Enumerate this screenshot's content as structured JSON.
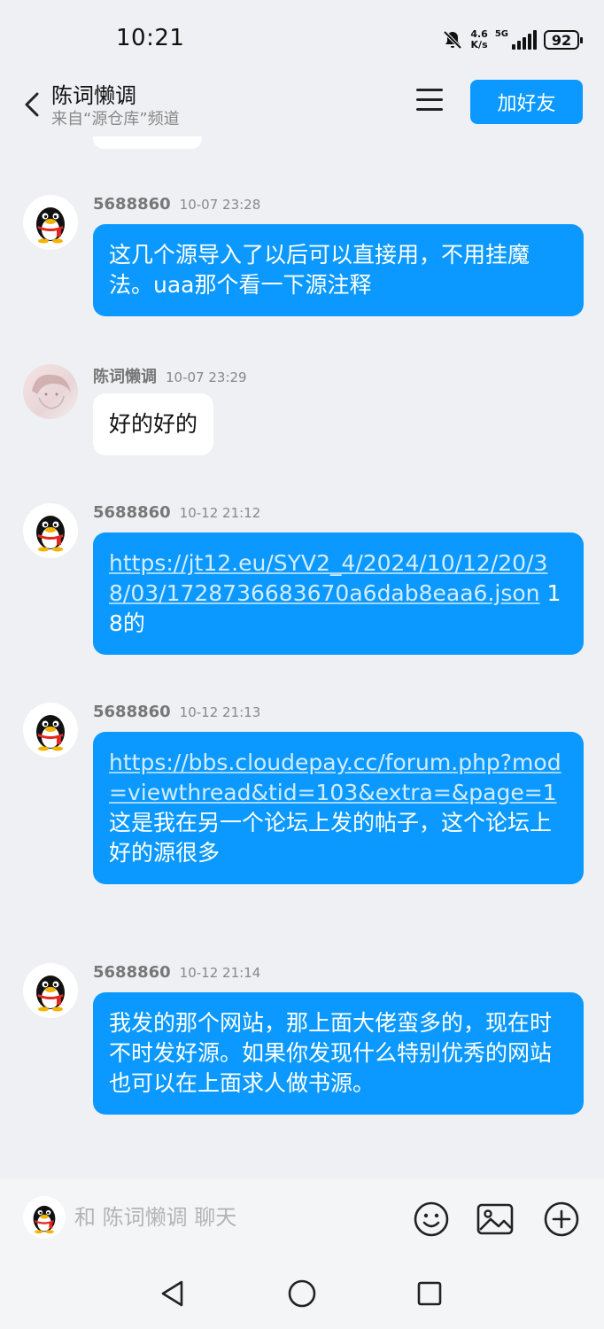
{
  "status_bar": {
    "time": "10:21",
    "net_speed_value": "4.6",
    "net_speed_unit": "K/s",
    "network": "5G",
    "battery": "92"
  },
  "header": {
    "title": "陈词懒调",
    "subtitle": "来自“源仓库”频道",
    "add_friend_label": "加好友"
  },
  "messages": [
    {
      "sender": "5688860",
      "time": "10-07 23:28",
      "text": "这几个源导入了以后可以直接用，不用挂魔法。uaa那个看一下源注释"
    },
    {
      "sender": "陈词懒调",
      "time": "10-07 23:29",
      "text": "好的好的"
    },
    {
      "sender": "5688860",
      "time": "10-12 21:12",
      "link": "https://jt12.eu/SYV2_4/2024/10/12/20/38/03/1728736683670a6dab8eaa6.json",
      "text": " 18的"
    },
    {
      "sender": "5688860",
      "time": "10-12 21:13",
      "link": "https://bbs.cloudepay.cc/forum.php?mod=viewthread&tid=103&extra=&page=1",
      "text": "这是我在另一个论坛上发的帖子，这个论坛上好的源很多"
    },
    {
      "sender": "5688860",
      "time": "10-12 21:14",
      "text": "我发的那个网站，那上面大佬蛮多的，现在时不时发好源。如果你发现什么特别优秀的网站也可以在上面求人做书源。"
    }
  ],
  "input": {
    "placeholder": "和 陈词懒调 聊天"
  },
  "colors": {
    "accent": "#0b99ff",
    "background": "#eef0f3"
  }
}
